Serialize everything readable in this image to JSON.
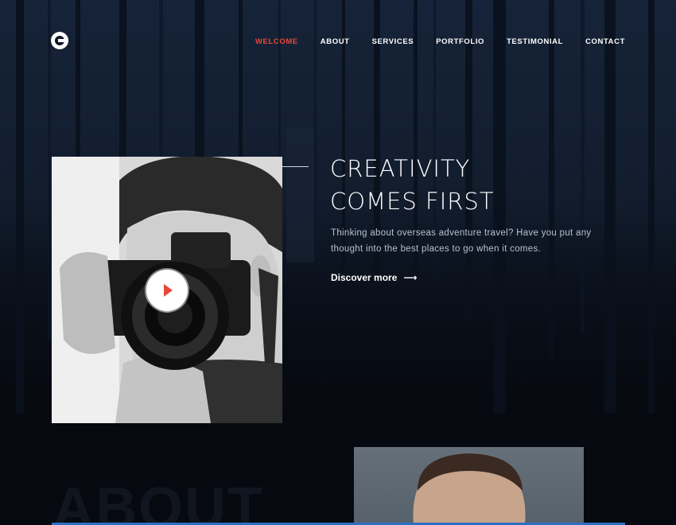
{
  "nav": {
    "logo": "logo-icon",
    "items": [
      {
        "label": "WELCOME",
        "active": true
      },
      {
        "label": "ABOUT",
        "active": false
      },
      {
        "label": "SERVICES",
        "active": false
      },
      {
        "label": "PORTFOLIO",
        "active": false
      },
      {
        "label": "TESTIMONIAL",
        "active": false
      },
      {
        "label": "CONTACT",
        "active": false
      }
    ]
  },
  "hero": {
    "title_line1": "CREATIVITY",
    "title_line2": "COMES FIRST",
    "text": "Thinking about overseas adventure travel? Have you put any thought into the best places to go when it comes.",
    "cta": "Discover more",
    "cta_icon": "arrow-right-icon",
    "play_icon": "play-icon"
  },
  "about": {
    "ghost_title": "ABOUT"
  },
  "colors": {
    "accent": "#e8473a",
    "background": "#080c14",
    "bar": "#2d6fc4"
  }
}
